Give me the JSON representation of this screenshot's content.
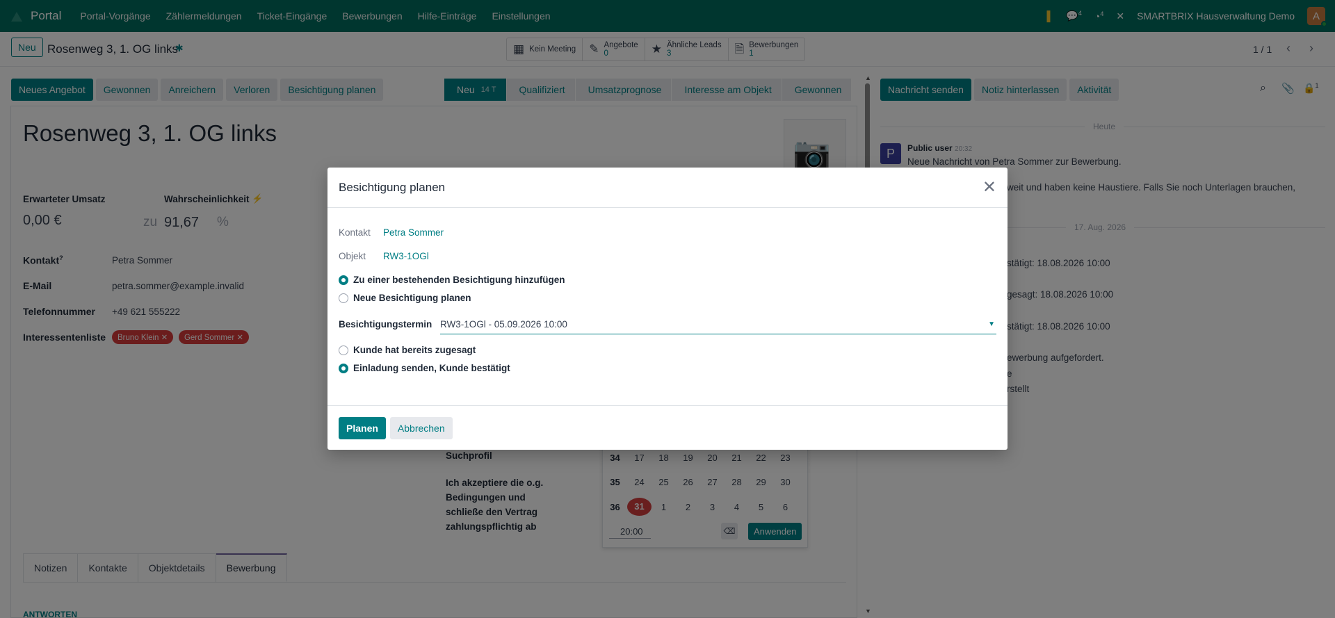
{
  "topnav": {
    "brand": "Portal",
    "menu": [
      "Portal-Vorgänge",
      "Zählermeldungen",
      "Ticket-Eingänge",
      "Bewerbungen",
      "Hilfe-Einträge",
      "Einstellungen"
    ],
    "messages_count": "4",
    "activities_count": "4",
    "company": "SMARTBRIX Hausverwaltung Demo",
    "avatar_letter": "A"
  },
  "control_panel": {
    "new_label": "Neu",
    "record_title": "Rosenweg 3, 1. OG links",
    "stats": [
      {
        "icon": "calendar-icon",
        "label": "Kein Meeting",
        "value": ""
      },
      {
        "icon": "edit-icon",
        "label": "Angebote",
        "value": "0"
      },
      {
        "icon": "star-icon",
        "label": "Ähnliche Leads",
        "value": "3"
      },
      {
        "icon": "file-icon",
        "label": "Bewerbungen",
        "value": "1"
      }
    ],
    "pager": "1 / 1"
  },
  "form_header": {
    "buttons": [
      "Neues Angebot",
      "Gewonnen",
      "Anreichern",
      "Verloren",
      "Besichtigung planen"
    ],
    "stages": [
      {
        "label": "Neu",
        "count": "14 T",
        "active": true
      },
      {
        "label": "Qualifiziert",
        "count": ""
      },
      {
        "label": "Umsatzprognose",
        "count": ""
      },
      {
        "label": "Interesse am Objekt",
        "count": ""
      },
      {
        "label": "Gewonnen",
        "count": ""
      }
    ]
  },
  "form": {
    "title": "Rosenweg 3, 1. OG links",
    "expected_revenue_label": "Erwarteter Umsatz",
    "expected_revenue": "0,00 €",
    "probability_label": "Wahrscheinlichkeit",
    "probability_prefix": "zu",
    "probability": "91,67",
    "probability_unit": "%",
    "contact_label": "Kontakt",
    "contact_sup": "?",
    "contact": "Petra Sommer",
    "email_label": "E-Mail",
    "email": "petra.sommer@example.invalid",
    "phone_label": "Telefonnummer",
    "phone": "+49 621 555222",
    "interest_label": "Interessentenliste",
    "interest_tags": [
      "Bruno Klein",
      "Gerd Sommer"
    ],
    "search_profile_label": "Suchprofil",
    "accept_text": [
      "Ich akzeptiere die o.g.",
      "Bedingungen und",
      "schließe den Vertrag",
      "zahlungspflichtig ab"
    ],
    "tabs": [
      "Notizen",
      "Kontakte",
      "Objektdetails",
      "Bewerbung"
    ],
    "active_tab": "Bewerbung",
    "section_heading": "ANTWORTEN"
  },
  "datepicker": {
    "rows": [
      {
        "week": "34",
        "days": [
          "17",
          "18",
          "19",
          "20",
          "21",
          "22",
          "23"
        ]
      },
      {
        "week": "35",
        "days": [
          "24",
          "25",
          "26",
          "27",
          "28",
          "29",
          "30"
        ]
      },
      {
        "week": "36",
        "days": [
          "31",
          "1",
          "2",
          "3",
          "4",
          "5",
          "6"
        ]
      }
    ],
    "today": "31",
    "time": "20:00",
    "apply_label": "Anwenden"
  },
  "chatter": {
    "buttons": [
      "Nachricht senden",
      "Notiz hinterlassen",
      "Aktivität"
    ],
    "followers_count": "1",
    "today_label": "Heute",
    "message_author": "Public user",
    "message_time": "20:32",
    "message_text": "Neue Nachricht von Petra Sommer zur Bewerbung.",
    "line2": "weit und haben keine Haustiere. Falls Sie noch Unterlagen brauchen,",
    "date_sep": "17. Aug. 2026",
    "lines": [
      "stätigt: 18.08.2026 10:00",
      "gesagt: 18.08.2026 10:00",
      "stätigt: 18.08.2026 10:00",
      "ewerbung aufgefordert.",
      "e",
      "rstellt"
    ]
  },
  "dialog": {
    "title": "Besichtigung planen",
    "contact_label": "Kontakt",
    "contact": "Petra Sommer",
    "object_label": "Objekt",
    "object": "RW3-1OGl",
    "option_existing": "Zu einer bestehenden Besichtigung hinzufügen",
    "option_new": "Neue Besichtigung planen",
    "appointment_label": "Besichtigungstermin",
    "appointment_value": "RW3-1OGl - 05.09.2026 10:00",
    "option_already": "Kunde hat bereits zugesagt",
    "option_invite": "Einladung senden, Kunde bestätigt",
    "plan_label": "Planen",
    "cancel_label": "Abbrechen"
  }
}
